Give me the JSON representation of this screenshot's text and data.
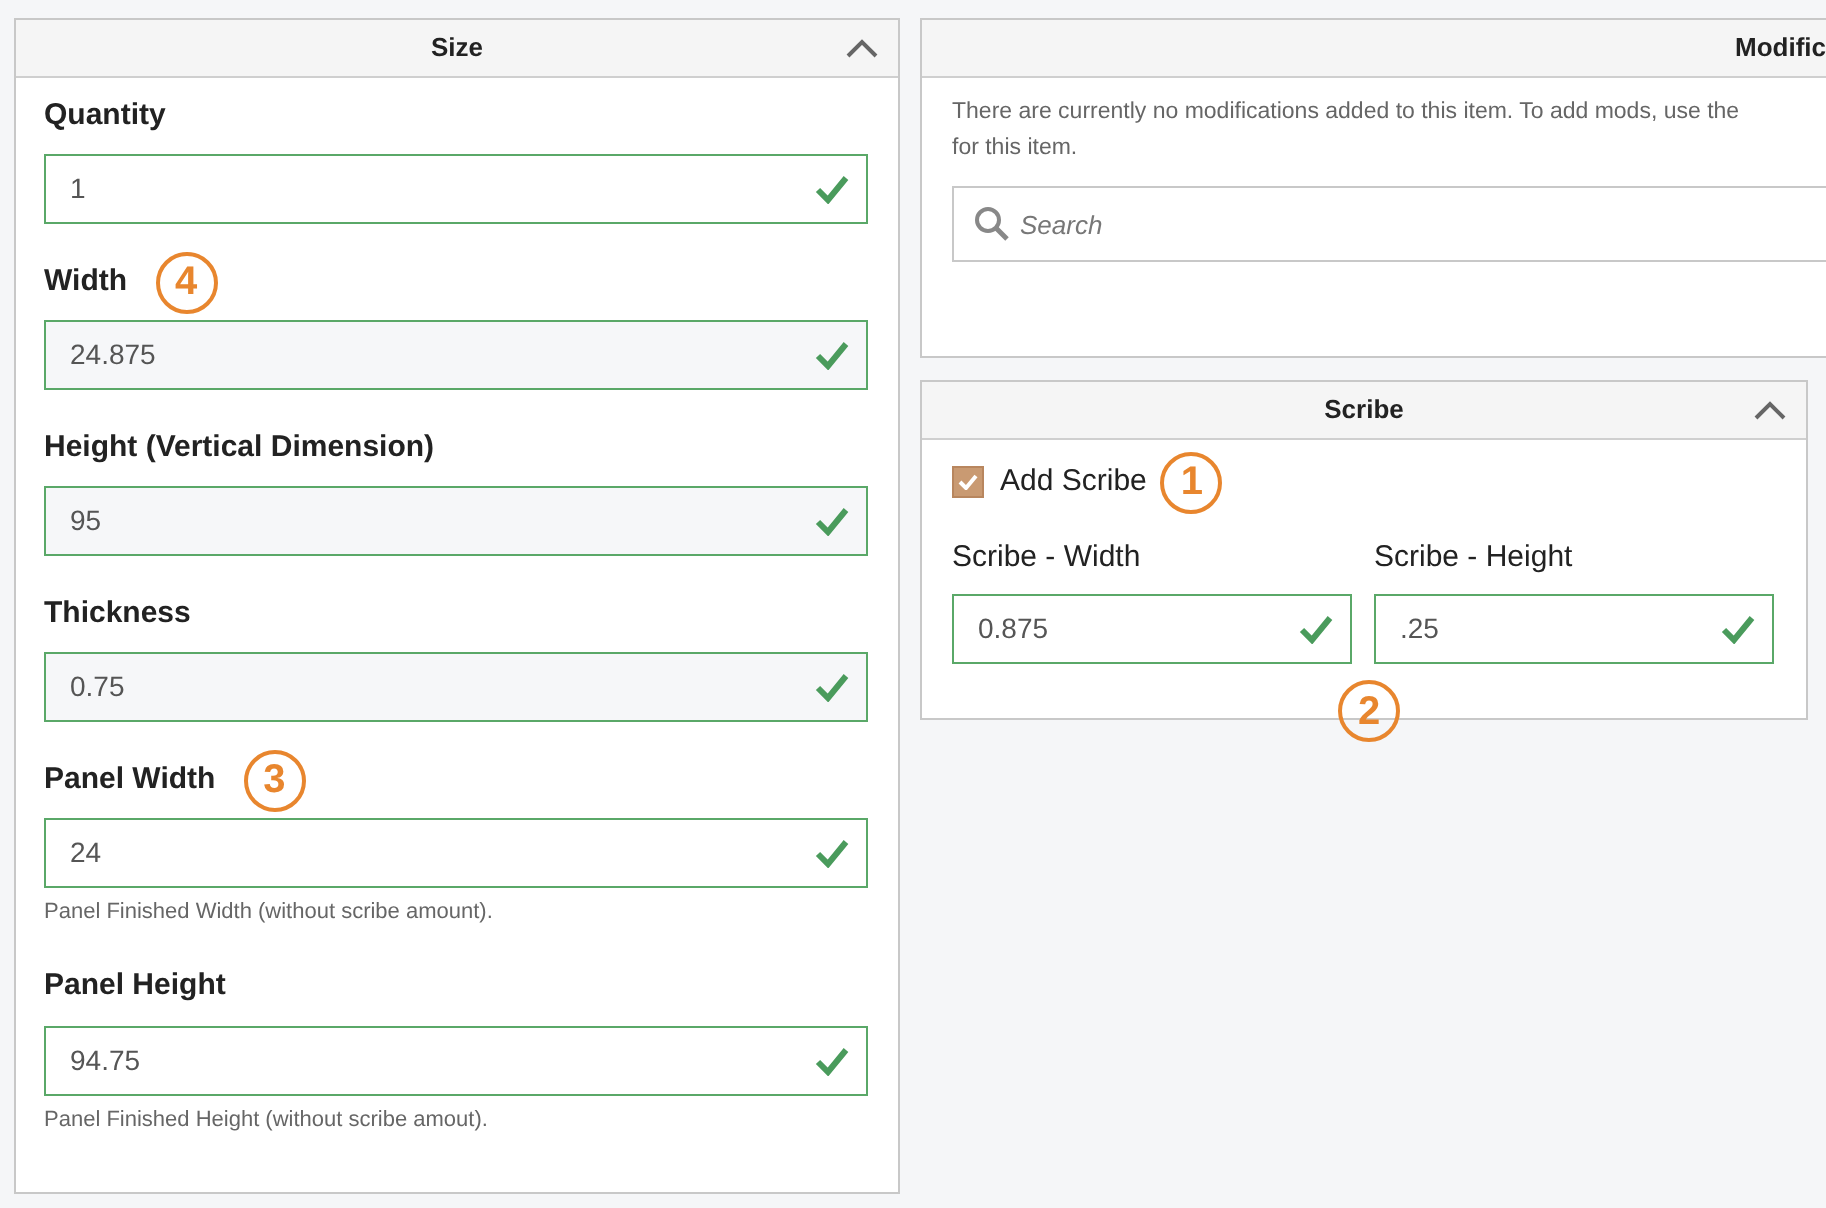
{
  "size_panel": {
    "title": "Size",
    "expanded": true,
    "fields": [
      {
        "label": "Quantity",
        "value": "1",
        "disabled": false,
        "valid": true
      },
      {
        "label": "Width",
        "value": "24.875",
        "disabled": true,
        "valid": true,
        "callout": "4"
      },
      {
        "label": "Height (Vertical Dimension)",
        "value": "95",
        "disabled": true,
        "valid": true
      },
      {
        "label": "Thickness",
        "value": "0.75",
        "disabled": true,
        "valid": true
      },
      {
        "label": "Panel Width",
        "value": "24",
        "disabled": false,
        "valid": true,
        "callout": "3",
        "help": "Panel Finished Width (without scribe amount)."
      },
      {
        "label": "Panel Height",
        "value": "94.75",
        "disabled": false,
        "valid": true,
        "help": "Panel Finished Height (without scribe amout)."
      }
    ]
  },
  "modifications_panel": {
    "title": "Modific",
    "message_lines": [
      "There are currently no modifications added to this item. To add mods, use the",
      "for this item."
    ],
    "search": {
      "placeholder": "Search"
    }
  },
  "scribe_panel": {
    "title": "Scribe",
    "expanded": true,
    "add_scribe": {
      "label": "Add Scribe",
      "checked": true,
      "callout": "1"
    },
    "fields": [
      {
        "label": "Scribe - Width",
        "value": "0.875",
        "valid": true
      },
      {
        "label": "Scribe - Height",
        "value": ".25",
        "valid": true
      }
    ],
    "fields_callout": "2"
  }
}
